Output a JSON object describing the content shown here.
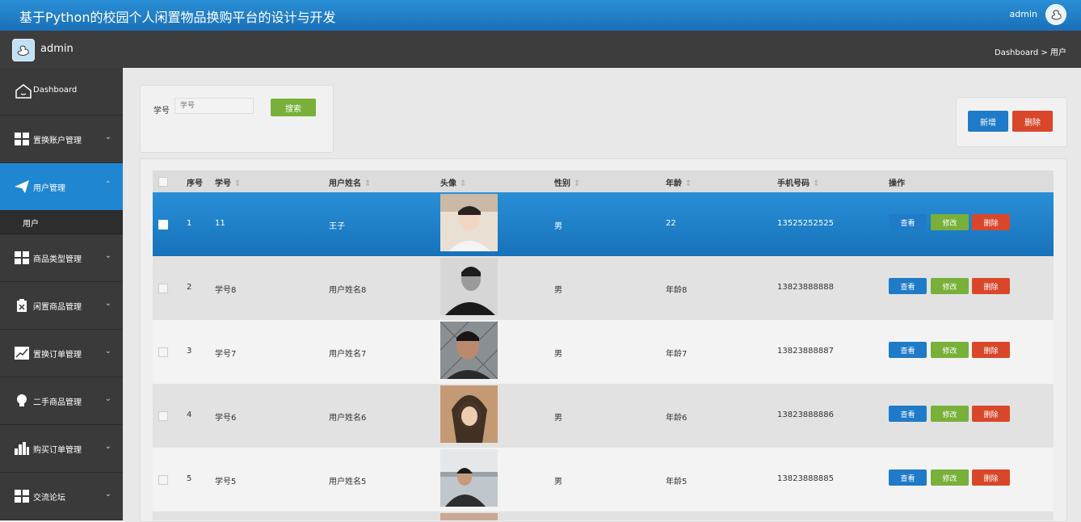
{
  "header": {
    "title": "基于Python的校园个人闲置物品换购平台的设计与开发",
    "user": "admin"
  },
  "subbar": {
    "name": "admin",
    "breadcrumb": "Dashboard > 用户"
  },
  "sidebar": {
    "items": [
      {
        "label": "Dashboard",
        "icon": "home-icon"
      },
      {
        "label": "置换账户管理",
        "icon": "grid-icon"
      },
      {
        "label": "用户管理",
        "icon": "send-icon",
        "active": true
      },
      {
        "label": "商品类型管理",
        "icon": "grid-icon"
      },
      {
        "label": "闲置商品管理",
        "icon": "clipboard-icon"
      },
      {
        "label": "置换订单管理",
        "icon": "chart-line-icon"
      },
      {
        "label": "二手商品管理",
        "icon": "lightbulb-icon"
      },
      {
        "label": "购买订单管理",
        "icon": "bar-chart-icon"
      },
      {
        "label": "交流论坛",
        "icon": "grid-icon"
      }
    ],
    "subitems": [
      {
        "label": "用户"
      }
    ]
  },
  "search": {
    "label": "学号",
    "placeholder": "学号",
    "button": "搜索"
  },
  "actions": {
    "add": "新增",
    "delete": "删除"
  },
  "table": {
    "columns": [
      "序号",
      "学号",
      "用户姓名",
      "头像",
      "性别",
      "年龄",
      "手机号码",
      "操作"
    ],
    "ops": {
      "view": "查看",
      "edit": "修改",
      "delete": "删除"
    },
    "rows": [
      {
        "index": "1",
        "id": "11",
        "name": "王子",
        "gender": "男",
        "age": "22",
        "phone": "13525252525"
      },
      {
        "index": "2",
        "id": "学号8",
        "name": "用户姓名8",
        "gender": "男",
        "age": "年龄8",
        "phone": "13823888888"
      },
      {
        "index": "3",
        "id": "学号7",
        "name": "用户姓名7",
        "gender": "男",
        "age": "年龄7",
        "phone": "13823888887"
      },
      {
        "index": "4",
        "id": "学号6",
        "name": "用户姓名6",
        "gender": "男",
        "age": "年龄6",
        "phone": "13823888886"
      },
      {
        "index": "5",
        "id": "学号5",
        "name": "用户姓名5",
        "gender": "男",
        "age": "年龄5",
        "phone": "13823888885"
      }
    ]
  },
  "colors": {
    "primary": "#1f86d1",
    "success": "#78b03a",
    "danger": "#d9472b",
    "sidebar": "#3a3a3a"
  }
}
